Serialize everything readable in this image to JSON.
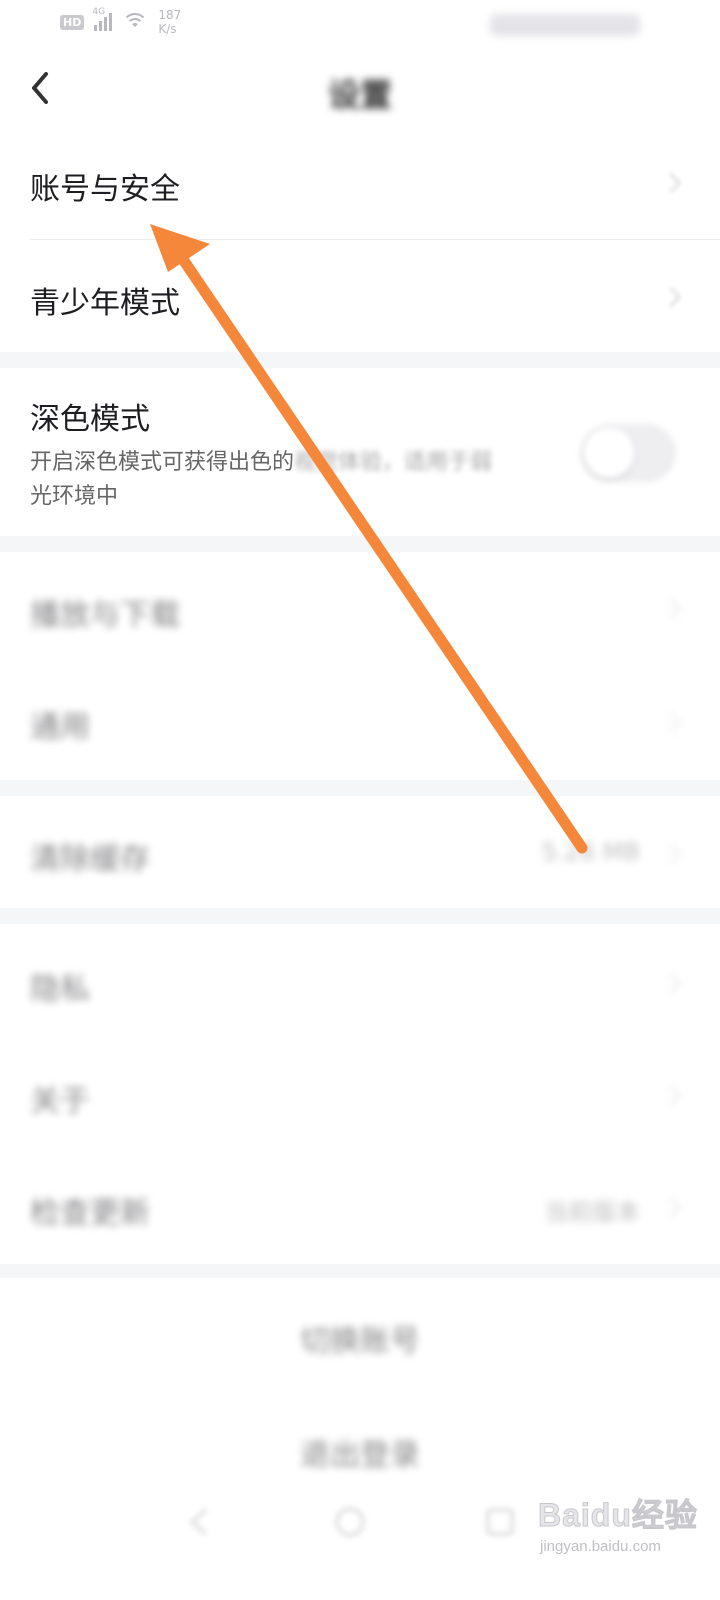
{
  "status_bar": {
    "hd": "HD",
    "network": "4G",
    "speed_value": "187",
    "speed_unit": "K/s"
  },
  "nav": {
    "title": "设置"
  },
  "rows": {
    "account": "账号与安全",
    "youth": "青少年模式",
    "dark_mode": {
      "label": "深色模式",
      "desc_clear": "开启深色模式可获得出色的",
      "desc_faded": "视觉体验，适用于弱",
      "desc_line2": "光环境中",
      "enabled": false
    },
    "play_download": "播放与下载",
    "general": "通用",
    "clear_cache": {
      "label": "清除缓存",
      "value": "5.26 MB"
    },
    "privacy": "隐私",
    "about": "关于",
    "check_update": {
      "label": "检查更新",
      "value": "当前版本"
    }
  },
  "buttons": {
    "switch_account": "切换账号",
    "logout": "退出登录"
  },
  "watermark": {
    "logo": "Baidu经验",
    "url": "jingyan.baidu.com"
  },
  "colors": {
    "arrow": "#f5873a",
    "background": "#ffffff",
    "section_gap": "#f5f6f8"
  }
}
